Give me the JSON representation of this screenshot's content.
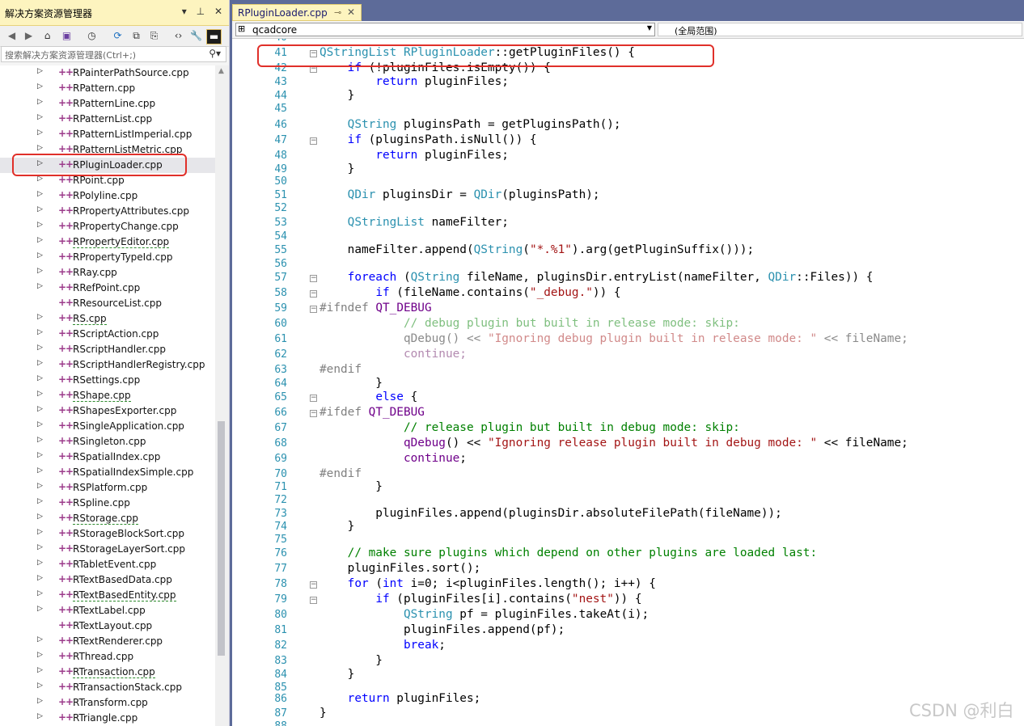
{
  "solution_explorer": {
    "title": "解决方案资源管理器",
    "title_buttons": [
      "▾",
      "⊥",
      "✕"
    ],
    "search_placeholder": "搜索解决方案资源管理器(Ctrl+;)",
    "items": [
      {
        "label": "RPainterPathSource.cpp",
        "expanded": false
      },
      {
        "label": "RPattern.cpp",
        "expanded": false
      },
      {
        "label": "RPatternLine.cpp",
        "expanded": false
      },
      {
        "label": "RPatternList.cpp",
        "expanded": false
      },
      {
        "label": "RPatternListImperial.cpp",
        "expanded": false
      },
      {
        "label": "RPatternListMetric.cpp",
        "expanded": false
      },
      {
        "label": "RPluginLoader.cpp",
        "expanded": false,
        "selected": true
      },
      {
        "label": "RPoint.cpp",
        "expanded": false
      },
      {
        "label": "RPolyline.cpp",
        "expanded": false
      },
      {
        "label": "RPropertyAttributes.cpp",
        "expanded": false
      },
      {
        "label": "RPropertyChange.cpp",
        "expanded": false
      },
      {
        "label": "RPropertyEditor.cpp",
        "expanded": false,
        "squiggle": true
      },
      {
        "label": "RPropertyTypeId.cpp",
        "expanded": false
      },
      {
        "label": "RRay.cpp",
        "expanded": false
      },
      {
        "label": "RRefPoint.cpp",
        "expanded": false
      },
      {
        "label": "RResourceList.cpp",
        "expanded": false,
        "no_arrow": true
      },
      {
        "label": "RS.cpp",
        "expanded": false,
        "squiggle": true
      },
      {
        "label": "RScriptAction.cpp",
        "expanded": false
      },
      {
        "label": "RScriptHandler.cpp",
        "expanded": false
      },
      {
        "label": "RScriptHandlerRegistry.cpp",
        "expanded": false
      },
      {
        "label": "RSettings.cpp",
        "expanded": false
      },
      {
        "label": "RShape.cpp",
        "expanded": false,
        "squiggle": true
      },
      {
        "label": "RShapesExporter.cpp",
        "expanded": false
      },
      {
        "label": "RSingleApplication.cpp",
        "expanded": false
      },
      {
        "label": "RSingleton.cpp",
        "expanded": false
      },
      {
        "label": "RSpatialIndex.cpp",
        "expanded": false
      },
      {
        "label": "RSpatialIndexSimple.cpp",
        "expanded": false
      },
      {
        "label": "RSPlatform.cpp",
        "expanded": false
      },
      {
        "label": "RSpline.cpp",
        "expanded": false
      },
      {
        "label": "RStorage.cpp",
        "expanded": false,
        "squiggle": true
      },
      {
        "label": "RStorageBlockSort.cpp",
        "expanded": false
      },
      {
        "label": "RStorageLayerSort.cpp",
        "expanded": false
      },
      {
        "label": "RTabletEvent.cpp",
        "expanded": false
      },
      {
        "label": "RTextBasedData.cpp",
        "expanded": false
      },
      {
        "label": "RTextBasedEntity.cpp",
        "expanded": false,
        "squiggle": true
      },
      {
        "label": "RTextLabel.cpp",
        "expanded": false
      },
      {
        "label": "RTextLayout.cpp",
        "expanded": false,
        "no_arrow": true
      },
      {
        "label": "RTextRenderer.cpp",
        "expanded": false
      },
      {
        "label": "RThread.cpp",
        "expanded": false
      },
      {
        "label": "RTransaction.cpp",
        "expanded": false,
        "squiggle": true
      },
      {
        "label": "RTransactionStack.cpp",
        "expanded": false
      },
      {
        "label": "RTransform.cpp",
        "expanded": false
      },
      {
        "label": "RTriangle.cpp",
        "expanded": false
      }
    ]
  },
  "editor": {
    "tab_label": "RPluginLoader.cpp",
    "project_dropdown": "qcadcore",
    "scope_dropdown": "(全局范围)",
    "code_lines": [
      {
        "n": "40",
        "h": ""
      },
      {
        "n": "41",
        "h": "<span class=\"ty\">QStringList</span> <span class=\"ty\">RPluginLoader</span>::getPluginFiles() {",
        "fold": true
      },
      {
        "n": "42",
        "h": "    <span class=\"kw\">if</span> (!pluginFiles.isEmpty()) {",
        "fold": true
      },
      {
        "n": "43",
        "h": "        <span class=\"kw\">return</span> pluginFiles;"
      },
      {
        "n": "44",
        "h": "    }"
      },
      {
        "n": "45",
        "h": ""
      },
      {
        "n": "46",
        "h": "    <span class=\"ty\">QString</span> pluginsPath = getPluginsPath();"
      },
      {
        "n": "47",
        "h": "    <span class=\"kw\">if</span> (pluginsPath.isNull()) {",
        "fold": true
      },
      {
        "n": "48",
        "h": "        <span class=\"kw\">return</span> pluginFiles;"
      },
      {
        "n": "49",
        "h": "    }"
      },
      {
        "n": "50",
        "h": ""
      },
      {
        "n": "51",
        "h": "    <span class=\"ty\">QDir</span> pluginsDir = <span class=\"ty\">QDir</span>(pluginsPath);"
      },
      {
        "n": "52",
        "h": ""
      },
      {
        "n": "53",
        "h": "    <span class=\"ty\">QStringList</span> nameFilter;"
      },
      {
        "n": "54",
        "h": ""
      },
      {
        "n": "55",
        "h": "    nameFilter.append(<span class=\"ty\">QString</span>(<span class=\"st\">\"*.%1\"</span>).arg(getPluginSuffix()));"
      },
      {
        "n": "56",
        "h": ""
      },
      {
        "n": "57",
        "h": "    <span class=\"kw\">foreach</span> (<span class=\"ty\">QString</span> fileName, pluginsDir.entryList(nameFilter, <span class=\"ty\">QDir</span>::Files)) {",
        "fold": true
      },
      {
        "n": "58",
        "h": "        <span class=\"kw\">if</span> (fileName.contains(<span class=\"st\">\"_debug.\"</span>)) {",
        "fold": true
      },
      {
        "n": "59",
        "h": "<span class=\"pp\">#ifndef</span> <span class=\"mc\">QT_DEBUG</span>",
        "fold": true,
        "pp": true
      },
      {
        "n": "60",
        "h": "            <span class=\"dim cm\" style=\"color:#7fbf7f\">// debug plugin but built in release mode: skip:</span>"
      },
      {
        "n": "61",
        "h": "            <span class=\"dk\">qDebug() &lt;&lt; </span><span style=\"color:#d18a8a\">\"Ignoring debug plugin built in release mode: \"</span><span class=\"dk\"> &lt;&lt; fileName;</span>"
      },
      {
        "n": "62",
        "h": "            <span class=\"dimmac\">continue;</span>"
      },
      {
        "n": "63",
        "h": "<span class=\"pp\">#endif</span>"
      },
      {
        "n": "64",
        "h": "        }"
      },
      {
        "n": "65",
        "h": "        <span class=\"kw\">else</span> {",
        "fold": true
      },
      {
        "n": "66",
        "h": "<span class=\"pp\">#ifdef</span> <span class=\"mc\">QT_DEBUG</span>",
        "fold": true
      },
      {
        "n": "67",
        "h": "            <span class=\"cm\">// release plugin but built in debug mode: skip:</span>"
      },
      {
        "n": "68",
        "h": "            <span class=\"mc\">qDebug</span>() &lt;&lt; <span class=\"st\">\"Ignoring release plugin built in debug mode: \"</span> &lt;&lt; fileName;"
      },
      {
        "n": "69",
        "h": "            <span class=\"mc\">continue</span>;"
      },
      {
        "n": "70",
        "h": "<span class=\"pp\">#endif</span>"
      },
      {
        "n": "71",
        "h": "        }"
      },
      {
        "n": "72",
        "h": ""
      },
      {
        "n": "73",
        "h": "        pluginFiles.append(pluginsDir.absoluteFilePath(fileName));"
      },
      {
        "n": "74",
        "h": "    }"
      },
      {
        "n": "75",
        "h": ""
      },
      {
        "n": "76",
        "h": "    <span class=\"cm\">// make sure plugins which depend on other plugins are loaded last:</span>"
      },
      {
        "n": "77",
        "h": "    pluginFiles.sort();"
      },
      {
        "n": "78",
        "h": "    <span class=\"kw\">for</span> (<span class=\"kw\">int</span> i=0; i&lt;pluginFiles.length(); i++) {",
        "fold": true
      },
      {
        "n": "79",
        "h": "        <span class=\"kw\">if</span> (pluginFiles[i].contains(<span class=\"st\">\"nest\"</span>)) {",
        "fold": true
      },
      {
        "n": "80",
        "h": "            <span class=\"ty\">QString</span> pf = pluginFiles.takeAt(i);"
      },
      {
        "n": "81",
        "h": "            pluginFiles.append(pf);"
      },
      {
        "n": "82",
        "h": "            <span class=\"kw\">break</span>;"
      },
      {
        "n": "83",
        "h": "        }"
      },
      {
        "n": "84",
        "h": "    }"
      },
      {
        "n": "85",
        "h": ""
      },
      {
        "n": "86",
        "h": "    <span class=\"kw\">return</span> pluginFiles;"
      },
      {
        "n": "87",
        "h": "}"
      },
      {
        "n": "88",
        "h": ""
      }
    ]
  },
  "watermark": "CSDN @利白"
}
